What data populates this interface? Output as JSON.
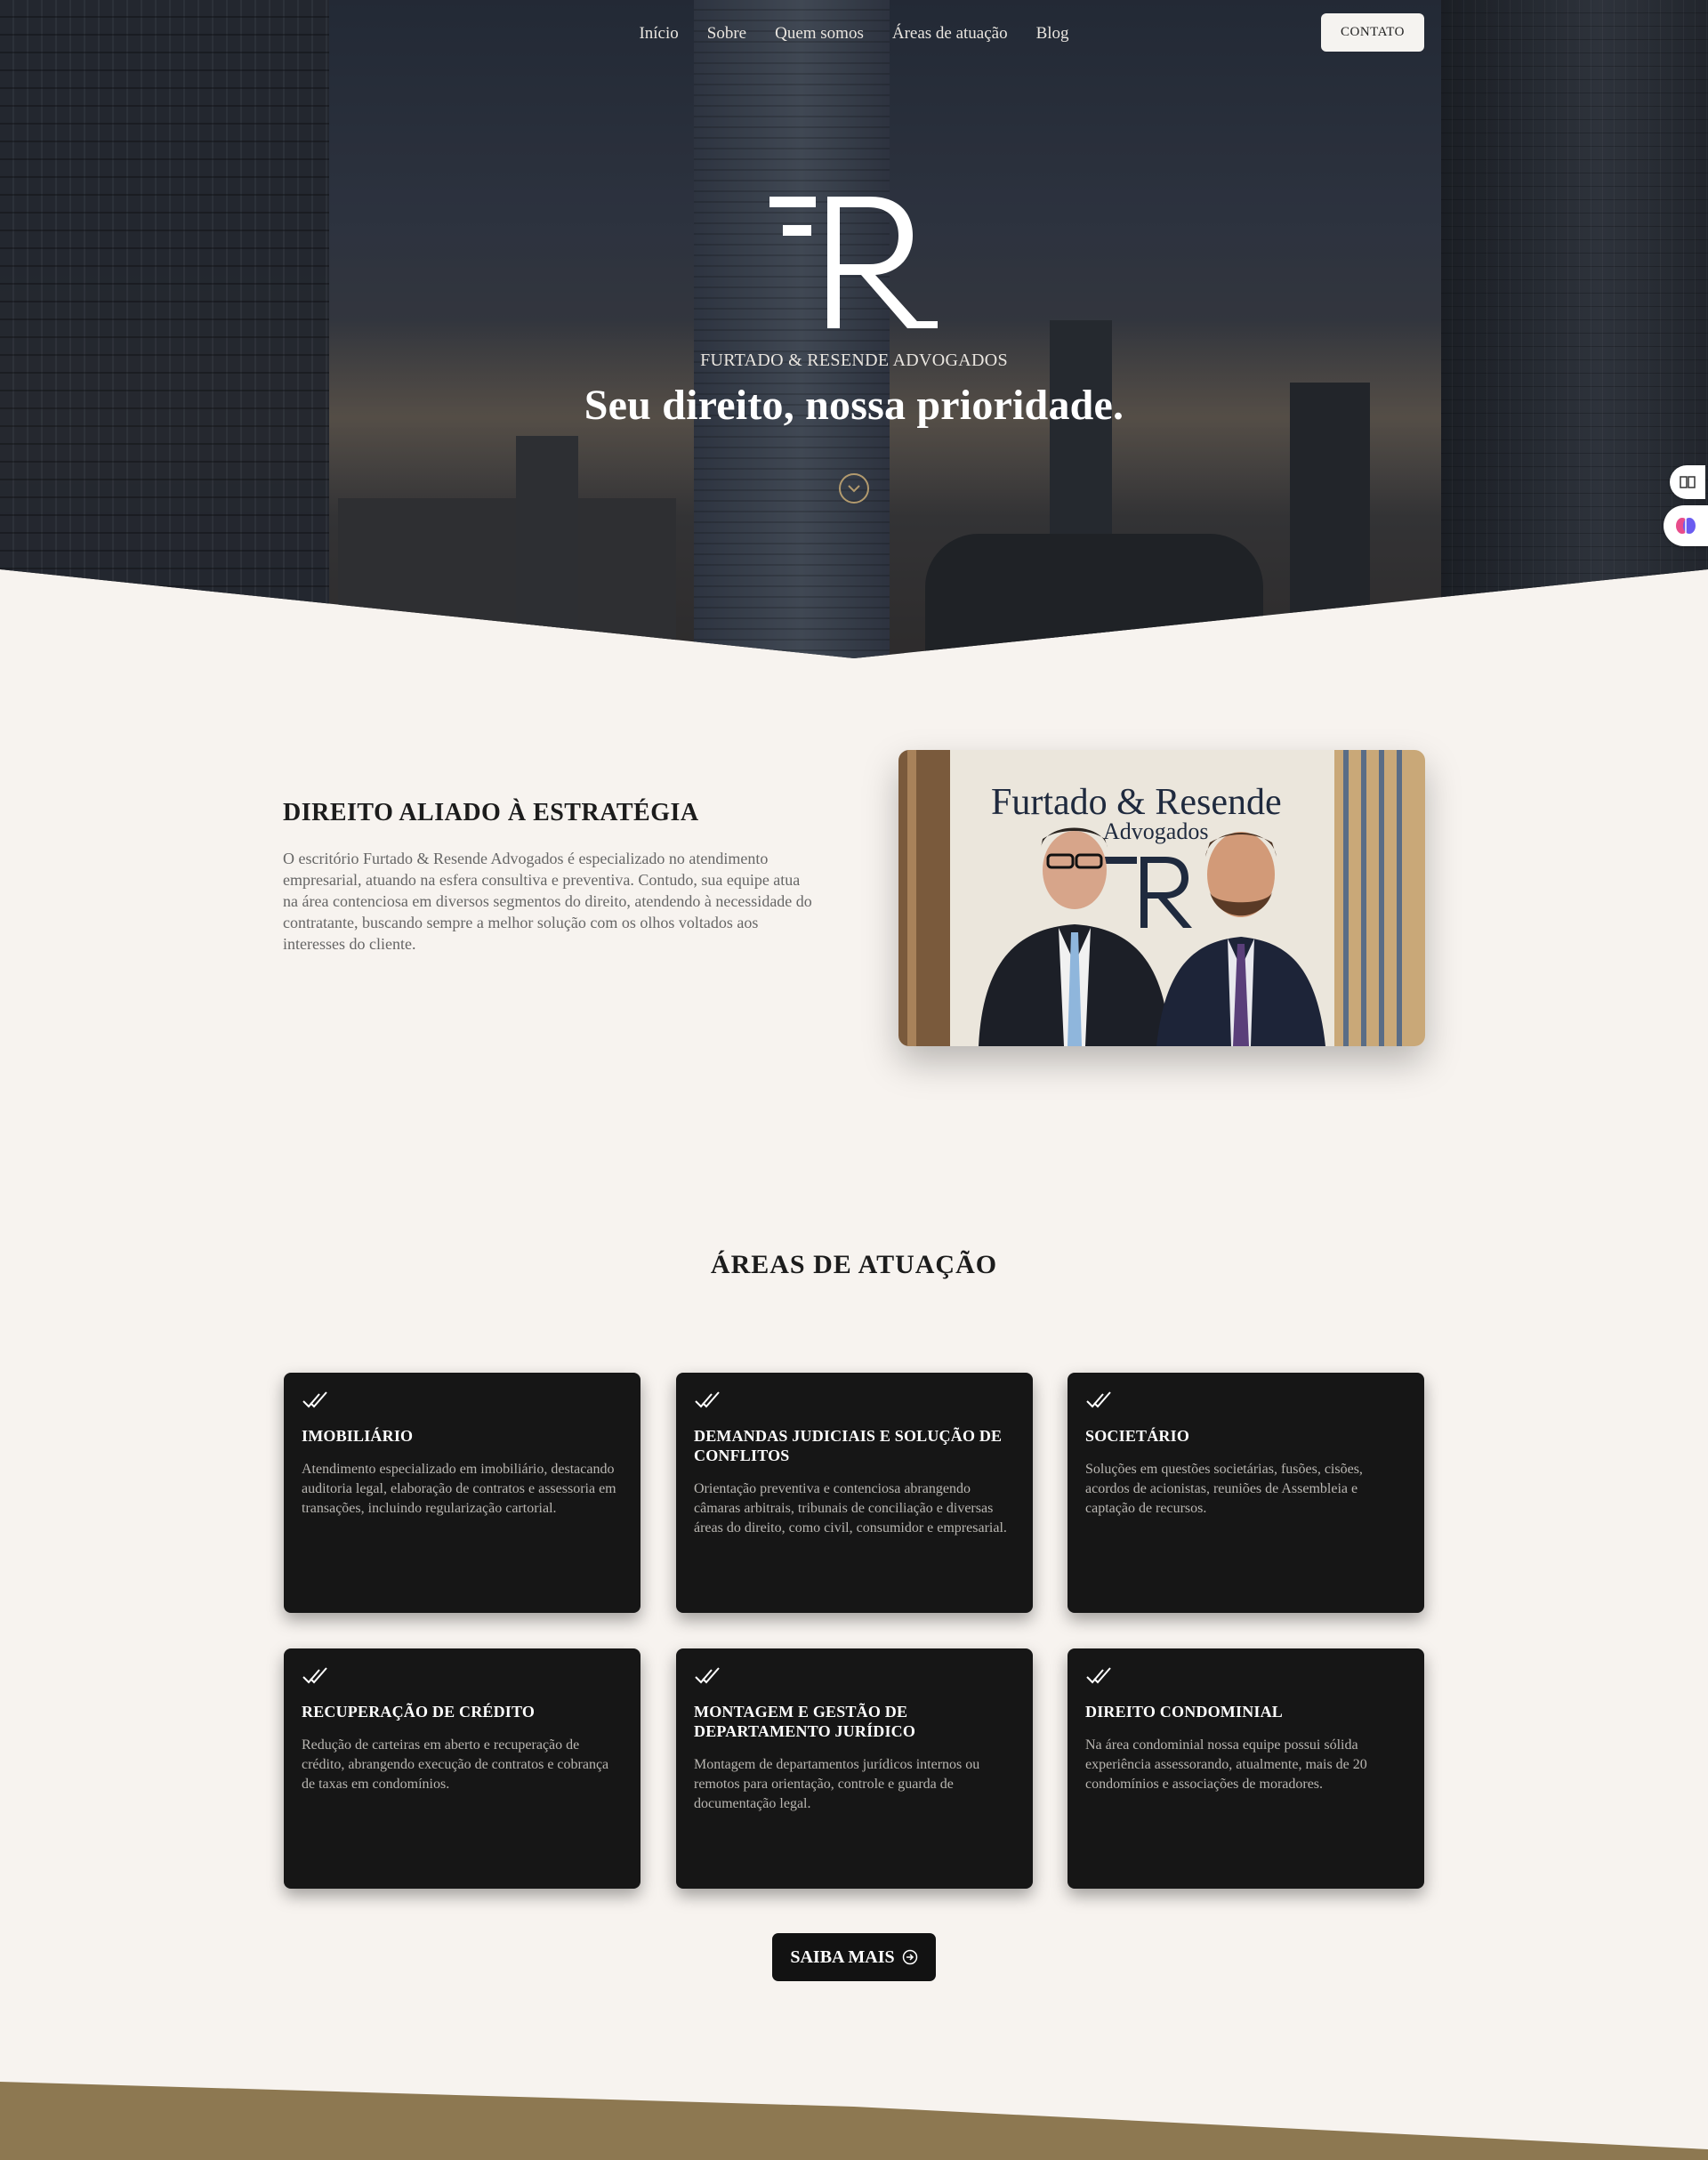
{
  "nav": {
    "items": [
      "Início",
      "Sobre",
      "Quem somos",
      "Áreas de atuação",
      "Blog"
    ],
    "contact_label": "CONTATO"
  },
  "hero": {
    "brand_name": "FURTADO & RESENDE ADVOGADOS",
    "tagline": "Seu direito, nossa prioridade."
  },
  "about": {
    "title_light": "DIREITO ALIADO À ",
    "title_bold": "ESTRATÉGIA",
    "text": "O escritório Furtado & Resende Advogados é especializado no atendimento empresarial, atuando na esfera consultiva e preventiva. Contudo, sua equipe atua na área contenciosa em diversos segmentos do direito, atendendo à necessidade do contratante, buscando sempre a melhor solução com os olhos voltados aos interesses do cliente.",
    "photo_sign_line1": "Furtado & Resende",
    "photo_sign_line2": "Advogados"
  },
  "areas": {
    "title": "ÁREAS DE ATUAÇÃO",
    "cards": [
      {
        "title": "IMOBILIÁRIO",
        "text": "Atendimento especializado em imobiliário, destacando auditoria legal, elaboração de contratos e assessoria em transações, incluindo regularização cartorial."
      },
      {
        "title": "DEMANDAS JUDICIAIS E SOLUÇÃO DE CONFLITOS",
        "text": "Orientação preventiva e contenciosa abrangendo câmaras arbitrais, tribunais de conciliação e diversas áreas do direito, como civil, consumidor e empresarial."
      },
      {
        "title": "SOCIETÁRIO",
        "text": "Soluções em questões societárias, fusões, cisões, acordos de acionistas, reuniões de Assembleia e captação de recursos."
      },
      {
        "title": "RECUPERAÇÃO DE CRÉDITO",
        "text": "Redução de carteiras em aberto e recuperação de crédito, abrangendo execução de contratos e cobrança de taxas em condomínios."
      },
      {
        "title": "MONTAGEM E GESTÃO DE DEPARTAMENTO JURÍDICO",
        "text": "Montagem de departamentos jurídicos internos ou remotos para orientação, controle e guarda de documentação legal."
      },
      {
        "title": "DIREITO CONDOMINIAL",
        "text": "Na área condominial nossa equipe possui sólida experiência assessorando, atualmente, mais de 20 condomínios e associações de moradores."
      }
    ],
    "button_label": "SAIBA MAIS"
  },
  "colors": {
    "accent": "#8d7851",
    "card_bg": "#161616",
    "page_bg": "#f7f3ef"
  },
  "icons": [
    "chevron-down-icon",
    "check-double-icon",
    "arrow-right-circle-icon",
    "reader-icon",
    "brain-icon"
  ]
}
